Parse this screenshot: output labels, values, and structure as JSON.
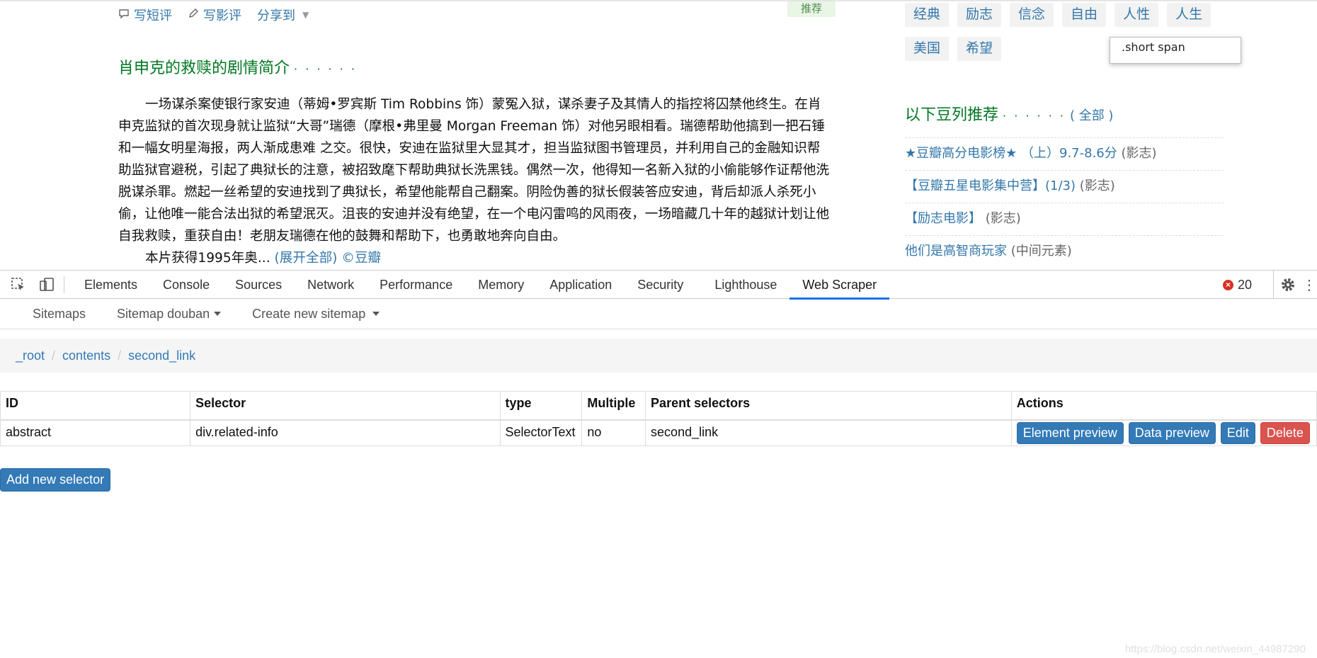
{
  "page": {
    "actions": {
      "short_review": "写短评",
      "film_review": "写影评",
      "share": "分享到"
    },
    "recommend_badge": "推荐",
    "summary_title": "肖申克的救赎的剧情简介",
    "summary_title_dots": "· · · · · ·",
    "summary_text": "一场谋杀案使银行家安迪（蒂姆•罗宾斯 Tim Robbins 饰）蒙冤入狱，谋杀妻子及其情人的指控将囚禁他终生。在肖申克监狱的首次现身就让监狱“大哥”瑞德（摩根•弗里曼 Morgan Freeman 饰）对他另眼相看。瑞德帮助他搞到一把石锤和一幅女明星海报，两人渐成患难 之交。很快，安迪在监狱里大显其才，担当监狱图书管理员，并利用自己的金融知识帮助监狱官避税，引起了典狱长的注意，被招致麾下帮助典狱长洗黑钱。偶然一次，他得知一名新入狱的小偷能够作证帮他洗脱谋杀罪。燃起一丝希望的安迪找到了典狱长，希望他能帮自己翻案。阴险伪善的狱长假装答应安迪，背后却派人杀死小偷，让他唯一能合法出狱的希望泯灭。沮丧的安迪并没有绝望，在一个电闪雷鸣的风雨夜，一场暗藏几十年的越狱计划让他自我救赎，重获自由！老朋友瑞德在他的鼓舞和帮助下，也勇敢地奔向自由。",
    "summary_text2": "本片获得1995年奥...",
    "expand_all": "(展开全部)",
    "copyright": "©豆瓣",
    "tags": [
      "经典",
      "励志",
      "信念",
      "自由",
      "人性",
      "人生",
      "美国",
      "希望"
    ],
    "tooltip": ".short span",
    "doulist_title": "以下豆列推荐",
    "doulist_dots": "· · · · · ·",
    "doulist_all": "( 全部 )",
    "doulist": [
      {
        "name": "★豆瓣高分电影榜★ （上）9.7-8.6分",
        "meta": "(影志)"
      },
      {
        "name": "【豆瓣五星电影集中营】(1/3)",
        "meta": "(影志)"
      },
      {
        "name": "【励志电影】",
        "meta": "(影志)"
      },
      {
        "name": "他们是高智商玩家",
        "meta": "(中间元素)"
      }
    ]
  },
  "devtools": {
    "tabs": [
      "Elements",
      "Console",
      "Sources",
      "Network",
      "Performance",
      "Memory",
      "Application",
      "Security",
      "Lighthouse",
      "Web Scraper"
    ],
    "active_tab": "Web Scraper",
    "error_count": "20",
    "accent": "#1a73e8"
  },
  "webscraper": {
    "nav": {
      "sitemaps": "Sitemaps",
      "sitemap_douban": "Sitemap douban",
      "create_new": "Create new sitemap"
    },
    "breadcrumb": [
      "_root",
      "contents",
      "second_link"
    ],
    "table": {
      "headers": [
        "ID",
        "Selector",
        "type",
        "Multiple",
        "Parent selectors",
        "Actions"
      ],
      "rows": [
        {
          "id": "abstract",
          "selector": "div.related-info",
          "type": "SelectorText",
          "multiple": "no",
          "parent": "second_link"
        }
      ],
      "buttons": {
        "element_preview": "Element preview",
        "data_preview": "Data preview",
        "edit": "Edit",
        "delete": "Delete"
      }
    },
    "add_selector": "Add new selector",
    "primary_color": "#337ab7",
    "danger_color": "#d9534f"
  },
  "watermark": "https://blog.csdn.net/weixin_44987290"
}
